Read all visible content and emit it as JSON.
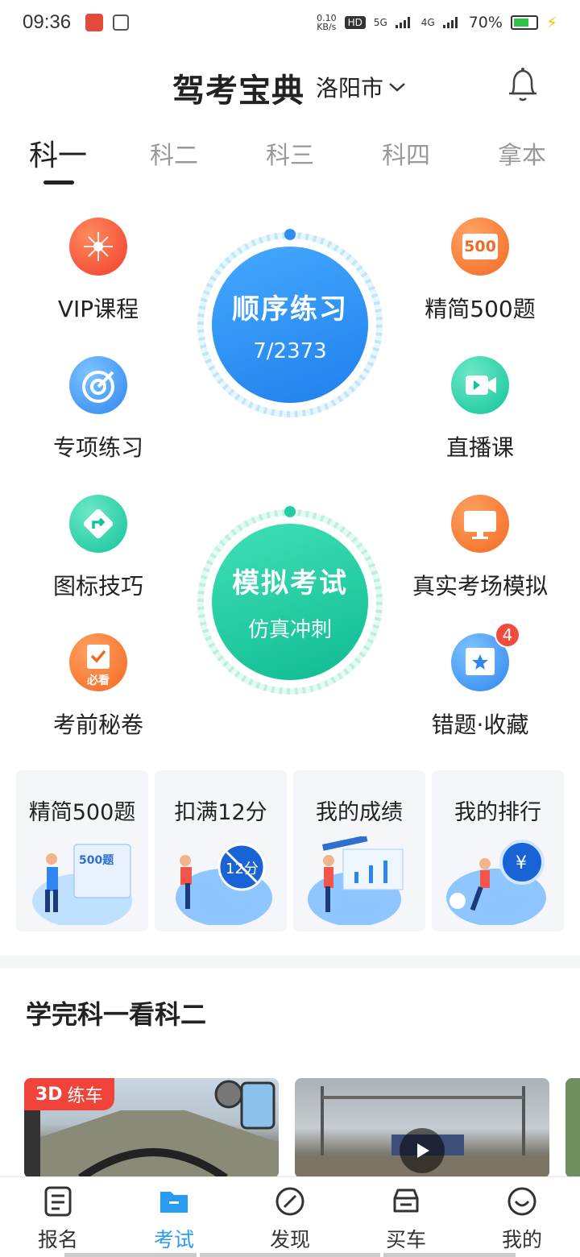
{
  "status": {
    "time": "09:36",
    "speed_top": "0.10",
    "speed_bottom": "KB/s",
    "hd": "HD",
    "hd_sub": "1",
    "net1": "5G",
    "net2": "4G",
    "battery": "70%",
    "battery_level": 0.7
  },
  "header": {
    "title": "驾考宝典",
    "city": "洛阳市"
  },
  "tabs": [
    {
      "label": "科一",
      "active": true
    },
    {
      "label": "科二"
    },
    {
      "label": "科三"
    },
    {
      "label": "科四"
    },
    {
      "label": "拿本"
    }
  ],
  "features": {
    "vip": "VIP课程",
    "special": "专项练习",
    "signs": "图标技巧",
    "secret": "考前秘卷",
    "secret_badge": "必看",
    "jingjian500": "精简500题",
    "jingjian500_icon": "500",
    "live": "直播课",
    "realexam": "真实考场模拟",
    "wrong": "错题·收藏",
    "wrong_badge": "4"
  },
  "practice": {
    "title": "顺序练习",
    "progress": "7/2373",
    "progress_value": 7,
    "progress_total": 2373
  },
  "exam": {
    "title": "模拟考试",
    "subtitle": "仿真冲刺"
  },
  "cards": [
    {
      "title": "精简500题",
      "art_text": "500题"
    },
    {
      "title": "扣满12分",
      "art_text": "12分"
    },
    {
      "title": "我的成绩"
    },
    {
      "title": "我的排行",
      "art_text": "¥"
    }
  ],
  "section": {
    "title": "学完科一看科二"
  },
  "videos": [
    {
      "tag": "3D",
      "tag_sub": "练车"
    },
    {
      "play": true
    }
  ],
  "nav": [
    {
      "label": "报名",
      "icon": "document-icon"
    },
    {
      "label": "考试",
      "icon": "folder-icon",
      "active": true
    },
    {
      "label": "发现",
      "icon": "compass-icon"
    },
    {
      "label": "买车",
      "icon": "car-icon"
    },
    {
      "label": "我的",
      "icon": "profile-icon"
    }
  ],
  "colors": {
    "accent": "#2a9bf2",
    "blue_circle": "#2f8ff0",
    "green_circle": "#1fcfa3",
    "badge": "#f24a3e"
  }
}
